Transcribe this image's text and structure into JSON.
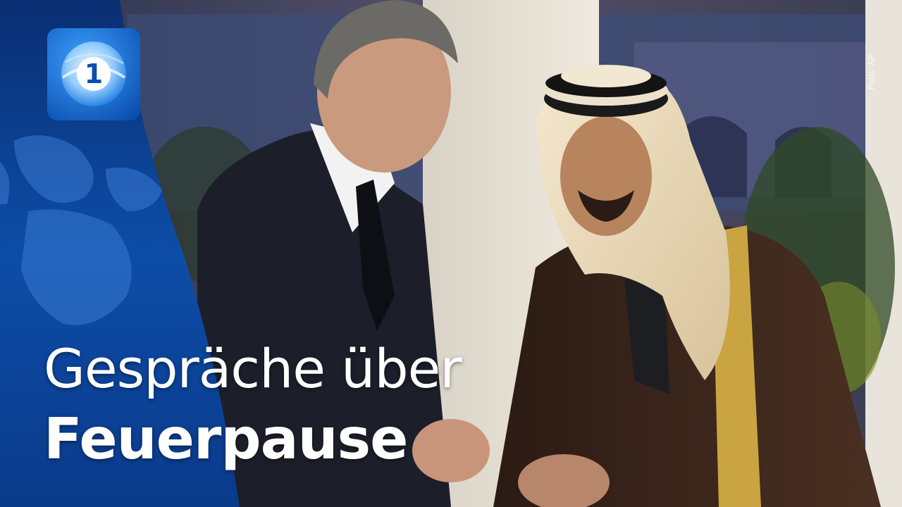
{
  "headline": {
    "line1": "Gespräche über",
    "line2": "Feuerpause"
  },
  "photo_credit": "Foto: AP",
  "logo": {
    "icon": "tagesschau-1-globe-icon",
    "glyph": "1"
  },
  "colors": {
    "brand_blue": "#0a4fa8",
    "logo_bg": "#1a6fd4",
    "text": "#ffffff"
  }
}
